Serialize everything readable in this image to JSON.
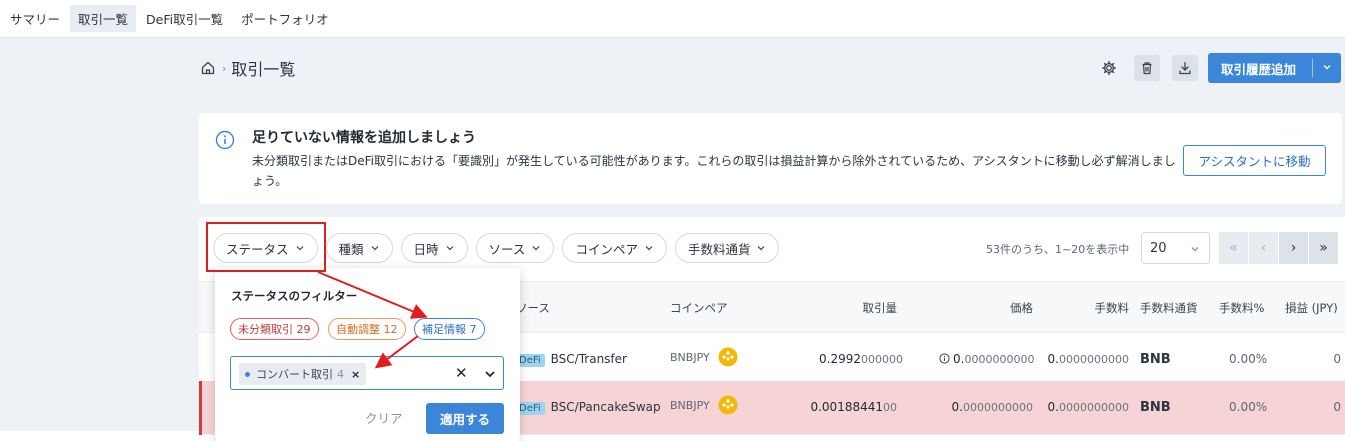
{
  "nav": {
    "tabs": [
      {
        "label": "サマリー",
        "active": false
      },
      {
        "label": "取引一覧",
        "active": true
      },
      {
        "label": "DeFi取引一覧",
        "active": false
      },
      {
        "label": "ポートフォリオ",
        "active": false
      }
    ]
  },
  "breadcrumb": {
    "home_icon": "home-icon",
    "title": "取引一覧"
  },
  "toolbar": {
    "settings_icon": "gear-icon",
    "delete_icon": "trash-icon",
    "download_icon": "download-icon",
    "add_label": "取引履歴追加"
  },
  "info": {
    "heading": "足りていない情報を追加しましょう",
    "body": "未分類取引またはDeFi取引における「要識別」が発生している可能性があります。これらの取引は損益計算から除外されているため、アシスタントに移動し必ず解消しましょう。",
    "button": "アシスタントに移動"
  },
  "filters": [
    {
      "label": "ステータス"
    },
    {
      "label": "種類"
    },
    {
      "label": "日時"
    },
    {
      "label": "ソース"
    },
    {
      "label": "コインペア"
    },
    {
      "label": "手数料通貨"
    }
  ],
  "pagination": {
    "info": "53件のうち、1~20を表示中",
    "page_size": "20",
    "first": "«",
    "prev": "‹",
    "next": "›",
    "last": "»"
  },
  "table": {
    "headers": {
      "source": "ソース",
      "pair": "コインペア",
      "amount": "取引量",
      "price": "価格",
      "fee": "手数料",
      "fee_currency": "手数料通貨",
      "fee_pct": "手数料%",
      "pnl": "損益 (JPY)"
    },
    "rows": [
      {
        "tag": "DeFi",
        "source": "BSC/Transfer",
        "pair": "BNBJPY",
        "amount_main": "0.2992",
        "amount_rest": "000000",
        "price_main": "0.",
        "price_rest": "0000000000",
        "fee_main": "0.",
        "fee_rest": "0000000000",
        "fee_currency": "BNB",
        "fee_pct": "0.00%",
        "pnl": "0",
        "highlight": false
      },
      {
        "tag": "DeFi",
        "source": "BSC/PancakeSwap",
        "pair": "BNBJPY",
        "amount_main": "0.00188441",
        "amount_rest": "00",
        "price_main": "0.",
        "price_rest": "0000000000",
        "fee_main": "0.",
        "fee_rest": "0000000000",
        "fee_currency": "BNB",
        "fee_pct": "0.00%",
        "pnl": "0",
        "highlight": true
      }
    ]
  },
  "status_filter": {
    "title": "ステータスのフィルター",
    "chips": [
      {
        "label": "未分類取引 29",
        "color": "#c03b3b"
      },
      {
        "label": "自動調整 12",
        "color": "#d06a1e"
      },
      {
        "label": "補足情報 7",
        "color": "#2b6fbd"
      }
    ],
    "selected_tag": {
      "label": "コンバート取引",
      "count": "4",
      "remove": "×"
    },
    "clear_icon": "✕",
    "clear_label": "クリア",
    "apply_label": "適用する"
  },
  "colors": {
    "accent": "#3b86d8",
    "annotation_red": "#e11d1d",
    "highlight_row": "#f6d4d5",
    "coin": "#f0b90b"
  }
}
